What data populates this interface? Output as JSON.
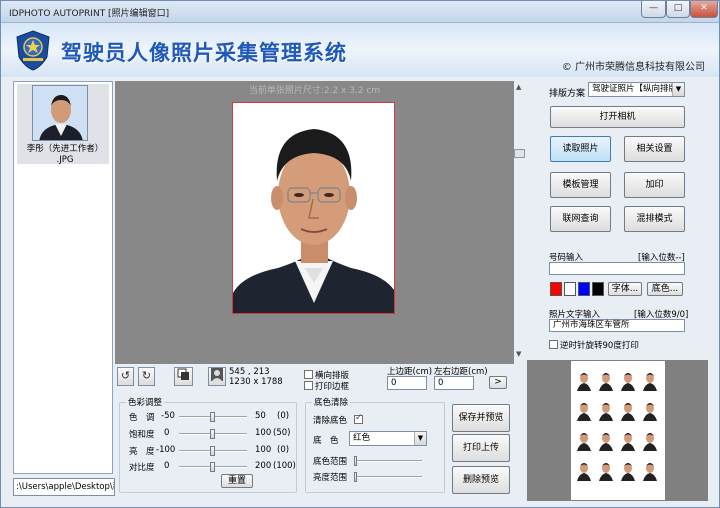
{
  "window": {
    "title": "IDPHOTO AUTOPRINT [照片编辑窗口]",
    "min_label": "—",
    "max_label": "□",
    "close_label": "✕"
  },
  "banner": {
    "title": "驾驶员人像照片采集管理系统",
    "copyright": "© 广州市荣腾信息科技有限公司"
  },
  "file_list": {
    "items": [
      {
        "name": "李彤（先进工作者）",
        "ext": ".JPG"
      }
    ]
  },
  "path": {
    "value": ":\\Users\\apple\\Desktop\\新建"
  },
  "preview": {
    "size_hint": "当前单张照片尺寸:2.2 x 3.2 cm"
  },
  "toolbar": {
    "rotate_left": "↺",
    "rotate_right": "↻",
    "pixels": "545 , 213",
    "dimensions": "1230 x 1788",
    "landscape_label": "横向排版",
    "print_border_label": "打印边框",
    "top_margin_label": "上边距(cm)",
    "top_margin_value": "0",
    "lr_margin_label": "左右边距(cm)",
    "lr_margin_value": "0",
    "go_label": ">"
  },
  "color_adjust": {
    "title": "色彩调整",
    "rows": [
      {
        "label": "色　调",
        "min": "-50",
        "value": "50",
        "paren": "(0)",
        "level": 0.5
      },
      {
        "label": "饱和度",
        "min": "0",
        "value": "100",
        "paren": "(50)",
        "level": 0.5
      },
      {
        "label": "亮　度",
        "min": "-100",
        "value": "100",
        "paren": "(0)",
        "level": 0.5
      },
      {
        "label": "对比度",
        "min": "0",
        "value": "200",
        "paren": "(100)",
        "level": 0.5
      }
    ],
    "reset_label": "重置"
  },
  "bg_remove": {
    "title": "底色清除",
    "clear_label": "清除底色",
    "color_label": "底　色",
    "color_value": "红色",
    "range_label": "底色范围",
    "bright_label": "亮度范围"
  },
  "actions": {
    "save_preview": "保存并预览",
    "print_upload": "打印上传",
    "delete_preview": "删除预览"
  },
  "right_panel": {
    "layout_label": "排版方案",
    "layout_value": "驾驶证照片【纵向排版",
    "open_camera": "打开相机",
    "read_photo": "读取照片",
    "settings": "相关设置",
    "template": "模板管理",
    "add_print": "加印",
    "online_query": "联网查询",
    "mix_mode": "混排模式",
    "number_label": "号码输入",
    "number_hint": "[输入位数--]",
    "font_btn": "字体...",
    "bgcolor_btn": "底色...",
    "text_label": "照片文字输入",
    "text_hint": "[输入位数9/0]",
    "text_value": "广州市海珠区车管所",
    "rotate_label": "逆时针旋转90度打印"
  },
  "colors": {
    "red": "#ff0000",
    "white": "#ffffff",
    "blue": "#0000ff",
    "black": "#000000",
    "accent": "#1e58b8"
  }
}
